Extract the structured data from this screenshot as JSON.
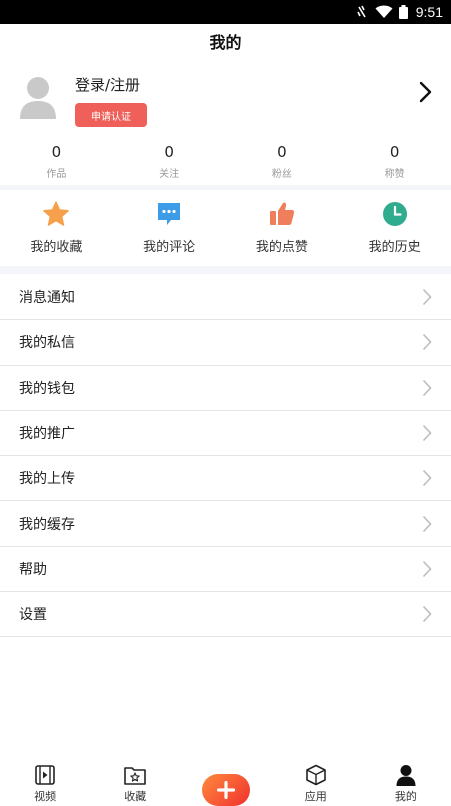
{
  "status_bar": {
    "time": "9:51"
  },
  "header": {
    "title": "我的"
  },
  "profile": {
    "login_label": "登录/注册",
    "verify_button": "申请认证"
  },
  "stats": [
    {
      "value": "0",
      "label": "作品"
    },
    {
      "value": "0",
      "label": "关注"
    },
    {
      "value": "0",
      "label": "粉丝"
    },
    {
      "value": "0",
      "label": "称赞"
    }
  ],
  "shortcuts": [
    {
      "label": "我的收藏",
      "icon": "star-icon",
      "color": "#f7a04b"
    },
    {
      "label": "我的评论",
      "icon": "comment-icon",
      "color": "#3d9ce8"
    },
    {
      "label": "我的点赞",
      "icon": "thumbs-up-icon",
      "color": "#ef7e5a"
    },
    {
      "label": "我的历史",
      "icon": "clock-icon",
      "color": "#2fab8d"
    }
  ],
  "menu": [
    {
      "label": "消息通知"
    },
    {
      "label": "我的私信"
    },
    {
      "label": "我的钱包"
    },
    {
      "label": "我的推广"
    },
    {
      "label": "我的上传"
    },
    {
      "label": "我的缓存"
    },
    {
      "label": "帮助"
    },
    {
      "label": "设置"
    }
  ],
  "tabbar": {
    "video": "视频",
    "favorites": "收藏",
    "publish_icon": "plus-icon",
    "apps": "应用",
    "mine": "我的"
  }
}
